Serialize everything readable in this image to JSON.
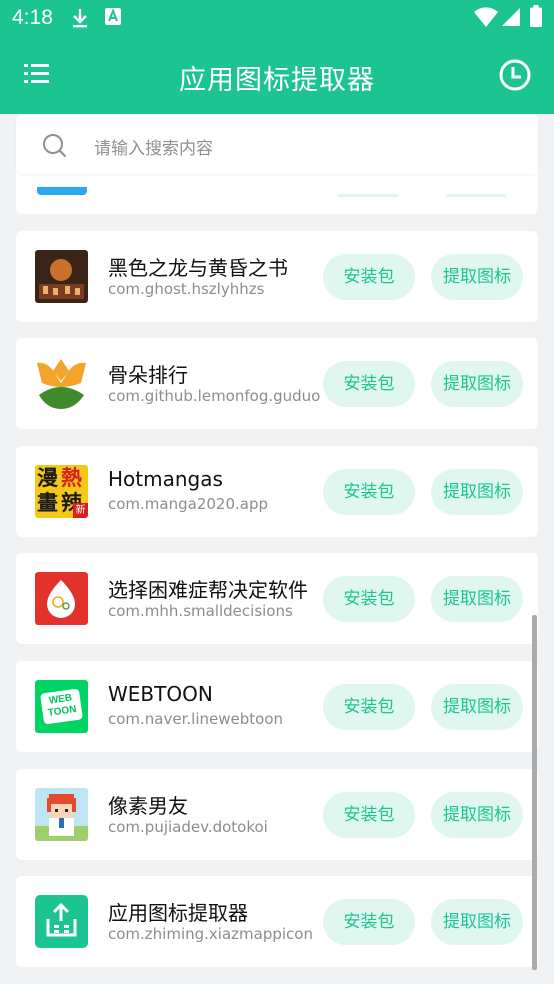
{
  "status_bar": {
    "time": "4:18",
    "icons": [
      "download-icon",
      "a-badge-icon",
      "wifi-icon",
      "signal-icon",
      "battery-icon"
    ]
  },
  "toolbar": {
    "title": "应用图标提取器",
    "menu_icon": "menu-icon",
    "history_icon": "clock-icon"
  },
  "search": {
    "placeholder": "请输入搜索内容",
    "icon": "search-icon"
  },
  "colors": {
    "accent": "#1cc492",
    "button_bg": "#e0f7ef",
    "page_bg": "#f1f2f4"
  },
  "apps": [
    {
      "name": "黑色之龙与黄昏之书",
      "package": "com.ghost.hszlyhhzs",
      "install_label": "安装包",
      "extract_label": "提取图标"
    },
    {
      "name": "骨朵排行",
      "package": "com.github.lemonfog.guduo",
      "install_label": "安装包",
      "extract_label": "提取图标"
    },
    {
      "name": "Hotmangas",
      "package": "com.manga2020.app",
      "install_label": "安装包",
      "extract_label": "提取图标"
    },
    {
      "name": "选择困难症帮决定软件",
      "package": "com.mhh.smalldecisions",
      "install_label": "安装包",
      "extract_label": "提取图标"
    },
    {
      "name": "WEBTOON",
      "package": "com.naver.linewebtoon",
      "install_label": "安装包",
      "extract_label": "提取图标"
    },
    {
      "name": "像素男友",
      "package": "com.pujiadev.dotokoi",
      "install_label": "安装包",
      "extract_label": "提取图标"
    },
    {
      "name": "应用图标提取器",
      "package": "com.zhiming.xiazmappicon",
      "install_label": "安装包",
      "extract_label": "提取图标"
    }
  ],
  "icon_text": {
    "hotmangas_1": "漫",
    "hotmangas_2": "熱",
    "hotmangas_3": "畫",
    "hotmangas_4": "辣",
    "hotmangas_badge": "新",
    "webtoon_1": "WEB",
    "webtoon_2": "TOON"
  }
}
